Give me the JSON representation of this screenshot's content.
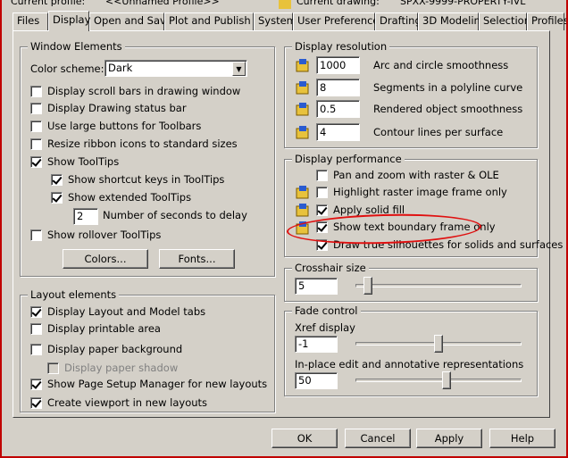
{
  "header": {
    "current_profile_label": "Current profile:",
    "current_profile_value": "<<Unnamed Profile>>",
    "current_drawing_label": "Current drawing:",
    "current_drawing_value": "SPXX-9999-PROPERTY-IVL"
  },
  "tabs": [
    "Files",
    "Display",
    "Open and Save",
    "Plot and Publish",
    "System",
    "User Preferences",
    "Drafting",
    "3D Modeling",
    "Selection",
    "Profiles"
  ],
  "active_tab": "Display",
  "window_elements": {
    "title": "Window Elements",
    "color_scheme_label": "Color scheme:",
    "color_scheme_value": "Dark",
    "display_scroll_bars": "Display scroll bars in drawing window",
    "display_status_bar": "Display Drawing status bar",
    "large_buttons": "Use large buttons for Toolbars",
    "resize_ribbon": "Resize ribbon icons to standard sizes",
    "show_tooltips": "Show ToolTips",
    "show_shortcut_keys": "Show shortcut keys in ToolTips",
    "show_extended_tooltips": "Show extended ToolTips",
    "seconds_value": "2",
    "seconds_label": "Number of seconds to delay",
    "show_rollover": "Show rollover ToolTips",
    "colors_button": "Colors...",
    "fonts_button": "Fonts..."
  },
  "layout_elements": {
    "title": "Layout elements",
    "layout_model_tabs": "Display Layout and Model tabs",
    "printable_area": "Display printable area",
    "paper_background": "Display paper background",
    "paper_shadow": "Display paper shadow",
    "page_setup_manager": "Show Page Setup Manager for new layouts",
    "create_viewport": "Create viewport in new layouts"
  },
  "display_resolution": {
    "title": "Display resolution",
    "items": [
      {
        "value": "1000",
        "label": "Arc and circle smoothness"
      },
      {
        "value": "8",
        "label": "Segments in a polyline curve"
      },
      {
        "value": "0.5",
        "label": "Rendered object smoothness"
      },
      {
        "value": "4",
        "label": "Contour lines per surface"
      }
    ]
  },
  "display_performance": {
    "title": "Display performance",
    "pan_zoom": "Pan and zoom with raster & OLE",
    "highlight_raster": "Highlight raster image frame only",
    "apply_solid_fill": "Apply solid fill",
    "text_boundary": "Show text boundary frame only",
    "true_silhouettes": "Draw true silhouettes for solids and surfaces"
  },
  "crosshair": {
    "title": "Crosshair size",
    "value": "5",
    "level": 0.05
  },
  "fade_control": {
    "title": "Fade control",
    "xref_label": "Xref display",
    "xref_value": "-1",
    "xref_level": 0.5,
    "inplace_label": "In-place edit and annotative representations",
    "inplace_value": "50",
    "inplace_level": 0.55
  },
  "buttons": {
    "ok": "OK",
    "cancel": "Cancel",
    "apply": "Apply",
    "help": "Help"
  },
  "colors": {
    "face": "#d4d0c8",
    "annotation_red": "#e01010"
  }
}
